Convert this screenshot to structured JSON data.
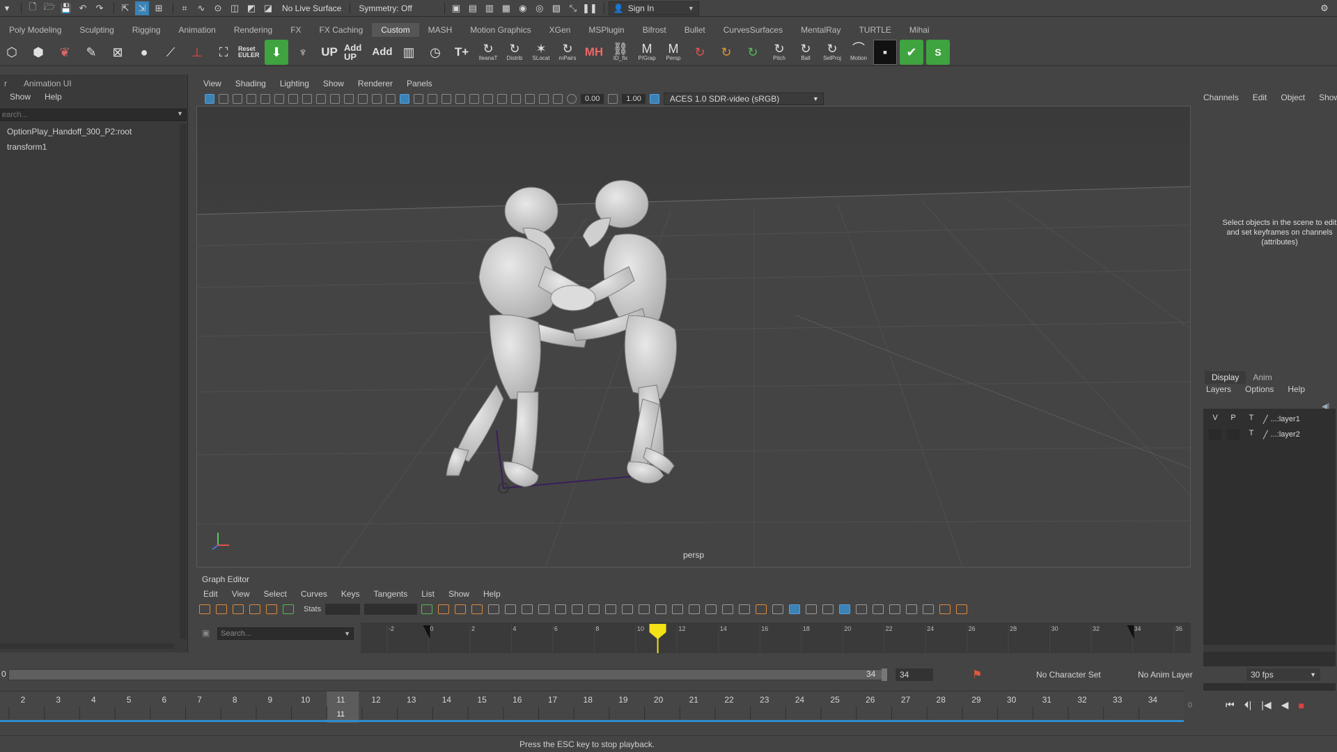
{
  "status_line": {
    "live_surface": "No Live Surface",
    "symmetry": "Symmetry: Off",
    "sign_in": "Sign In"
  },
  "shelf_tabs": [
    "Poly Modeling",
    "Sculpting",
    "Rigging",
    "Animation",
    "Rendering",
    "FX",
    "FX Caching",
    "Custom",
    "MASH",
    "Motion Graphics",
    "XGen",
    "MSPlugin",
    "Bifrost",
    "Bullet",
    "CurvesSurfaces",
    "MentalRay",
    "TURTLE",
    "Mihai"
  ],
  "shelf_active": "Custom",
  "shelf_buttons": {
    "reset_euler": "Reset EULER",
    "up": "UP",
    "add_up": "Add UP",
    "add": "Add",
    "t_plus": "T+",
    "mh": "MH",
    "labels": [
      "IleanaT",
      "Distrib",
      "SLocat",
      "mPairs",
      "ID_fix",
      "P/Grap",
      "Persp",
      "Pitch",
      "Ball",
      "SelProj",
      "Motion"
    ],
    "s_button": "S"
  },
  "outliner": {
    "tab": "Animation UI",
    "menu": [
      "Show",
      "Help"
    ],
    "search_placeholder": "earch...",
    "items": [
      "OptionPlay_Handoff_300_P2:root",
      "transform1"
    ]
  },
  "viewport": {
    "menu": [
      "View",
      "Shading",
      "Lighting",
      "Show",
      "Renderer",
      "Panels"
    ],
    "exposure": "0.00",
    "gamma": "1.00",
    "color_space": "ACES 1.0 SDR-video (sRGB)",
    "camera_label": "persp"
  },
  "graph_editor": {
    "title": "Graph Editor",
    "menu": [
      "Edit",
      "View",
      "Select",
      "Curves",
      "Keys",
      "Tangents",
      "List",
      "Show",
      "Help"
    ],
    "stats_label": "Stats",
    "search_placeholder": "Search...",
    "ruler": [
      "-2",
      "0",
      "2",
      "4",
      "6",
      "8",
      "10",
      "12",
      "14",
      "16",
      "18",
      "20",
      "22",
      "24",
      "26",
      "28",
      "30",
      "32",
      "34",
      "36"
    ],
    "current_frame": 11
  },
  "channel_box": {
    "menu": [
      "Channels",
      "Edit",
      "Object",
      "Show"
    ],
    "message": "Select objects in the scene to edit and set keyframes on channels (attributes)",
    "layer_tabs": [
      "Display",
      "Anim"
    ],
    "layer_menu": [
      "Layers",
      "Options",
      "Help"
    ],
    "layers": [
      {
        "v": "V",
        "p": "P",
        "t": "T",
        "name": "...:layer1"
      },
      {
        "v": "",
        "p": "",
        "t": "T",
        "name": "...:layer2"
      }
    ]
  },
  "range_bar": {
    "start": "0",
    "end_value": "34",
    "end_field": "34",
    "character_set": "No Character Set",
    "anim_layer": "No Anim Layer",
    "fps": "30 fps"
  },
  "time_slider": {
    "frames": [
      "2",
      "3",
      "4",
      "5",
      "6",
      "7",
      "8",
      "9",
      "10",
      "11",
      "12",
      "13",
      "14",
      "15",
      "16",
      "17",
      "18",
      "19",
      "20",
      "21",
      "22",
      "23",
      "24",
      "25",
      "26",
      "27",
      "28",
      "29",
      "30",
      "31",
      "32",
      "33",
      "34"
    ],
    "current_frame": "11",
    "current_field": "0"
  },
  "help_line": "Press the ESC key to stop playback."
}
